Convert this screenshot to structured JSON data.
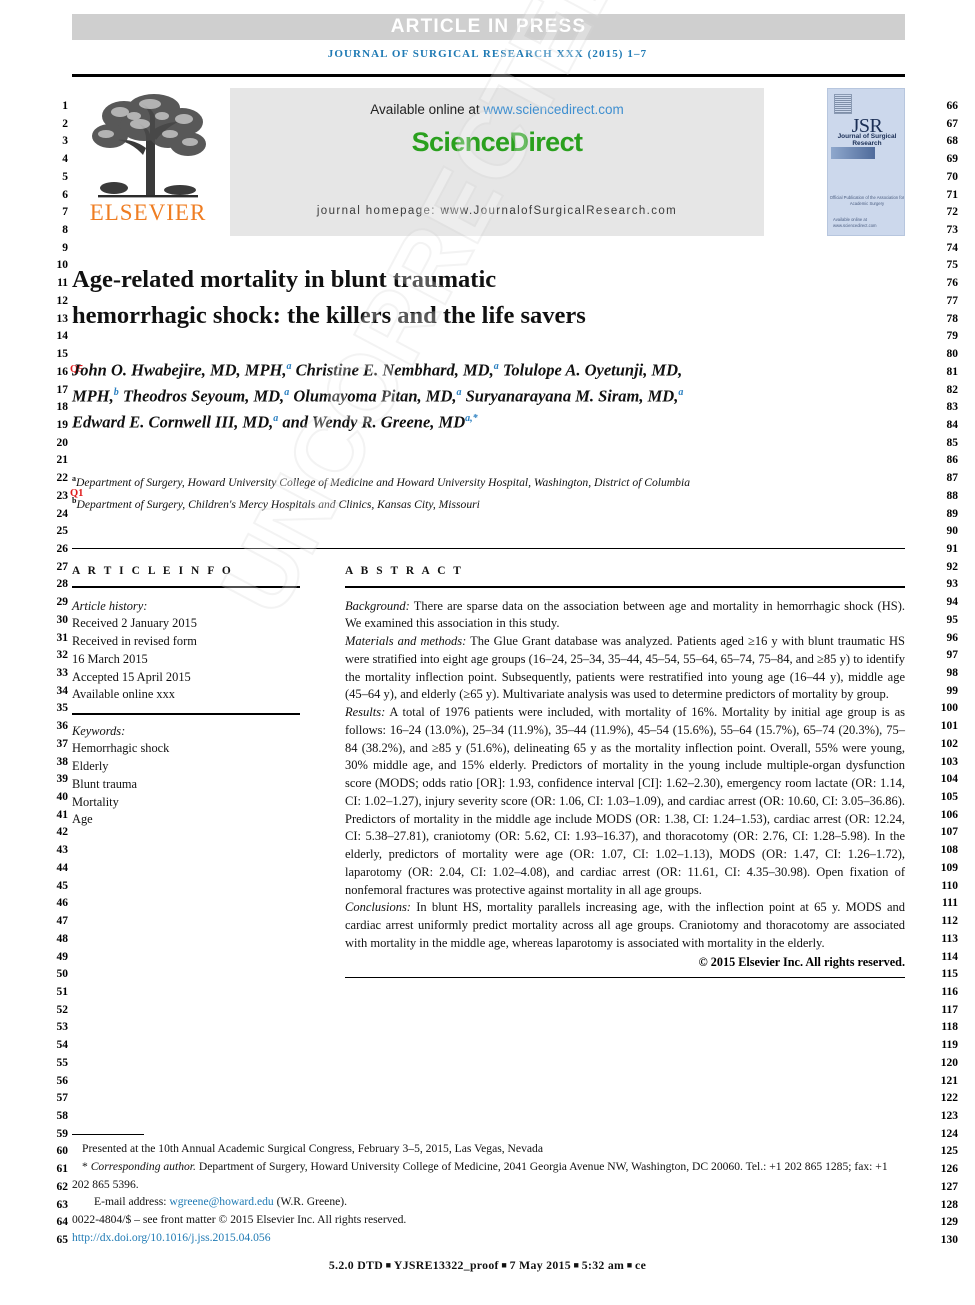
{
  "banner": {
    "article_in_press": "ARTICLE IN PRESS",
    "journal_citation": "JOURNAL OF SURGICAL RESEARCH XXX (2015) 1–7"
  },
  "masthead": {
    "publisher_logo_text": "ELSEVIER",
    "available_online_prefix": "Available online at",
    "sciencedirect_url": "www.sciencedirect.com",
    "sciencedirect_logo": "ScienceDirect",
    "journal_homepage": "journal homepage: www.JournalofSurgicalResearch.com",
    "cover": {
      "title": "JSR",
      "subtitle": "Journal of Surgical Research",
      "footnote": "Official Publication of the Association for Academic Surgery",
      "url_note": "Available online at www.sciencedirect.com"
    }
  },
  "article": {
    "title_line1": "Age-related mortality in blunt traumatic",
    "title_line2": "hemorrhagic shock: the killers and the life savers",
    "authors_html": "John O. Hwabejire, MD, MPH,<sup>a</sup> Christine E. Nembhard, MD,<sup>a</sup> Tolulope A. Oyetunji, MD, MPH,<sup>b</sup> Theodros Seyoum, MD,<sup>a</sup> Olumayoma Pitan, MD,<sup>a</sup> Suryanarayana M. Siram, MD,<sup>a</sup> Edward E. Cornwell III, MD,<sup>a</sup> and Wendy R. Greene, MD<sup>a,*</sup>",
    "affiliation_a": "Department of Surgery, Howard University College of Medicine and Howard University Hospital, Washington, District of Columbia",
    "affiliation_b": "Department of Surgery, Children's Mercy Hospitals and Clinics, Kansas City, Missouri",
    "affiliation_a_marker": "a",
    "affiliation_b_marker": "b"
  },
  "article_info": {
    "heading": "A R T I C L E   I N F O",
    "history_label": "Article history:",
    "history": [
      "Received 2 January 2015",
      "Received in revised form",
      "16 March 2015",
      "Accepted 15 April 2015",
      "Available online xxx"
    ],
    "keywords_label": "Keywords:",
    "keywords": [
      "Hemorrhagic shock",
      "Elderly",
      "Blunt trauma",
      "Mortality",
      "Age"
    ]
  },
  "abstract": {
    "heading": "A B S T R A C T",
    "sections": [
      {
        "label": "Background:",
        "text": " There are sparse data on the association between age and mortality in hemorrhagic shock (HS). We examined this association in this study."
      },
      {
        "label": "Materials and methods:",
        "text": " The Glue Grant database was analyzed. Patients aged ≥16 y with blunt traumatic HS were stratified into eight age groups (16–24, 25–34, 35–44, 45–54, 55–64, 65–74, 75–84, and ≥85 y) to identify the mortality inflection point. Subsequently, patients were restratified into young age (16–44 y), middle age (45–64 y), and elderly (≥65 y). Multivariate analysis was used to determine predictors of mortality by group."
      },
      {
        "label": "Results:",
        "text": " A total of 1976 patients were included, with mortality of 16%. Mortality by initial age group is as follows: 16–24 (13.0%), 25–34 (11.9%), 35–44 (11.9%), 45–54 (15.6%), 55–64 (15.7%), 65–74 (20.3%), 75–84 (38.2%), and ≥85 y (51.6%), delineating 65 y as the mortality inflection point. Overall, 55% were young, 30% middle age, and 15% elderly. Predictors of mortality in the young include multiple-organ dysfunction score (MODS; odds ratio [OR]: 1.93, confidence interval [CI]: 1.62–2.30), emergency room lactate (OR: 1.14, CI: 1.02–1.27), injury severity score (OR: 1.06, CI: 1.03–1.09), and cardiac arrest (OR: 10.60, CI: 3.05–36.86). Predictors of mortality in the middle age include MODS (OR: 1.38, CI: 1.24–1.53), cardiac arrest (OR: 12.24, CI: 5.38–27.81), craniotomy (OR: 5.62, CI: 1.93–16.37), and thoracotomy (OR: 2.76, CI: 1.28–5.98). In the elderly, predictors of mortality were age (OR: 1.07, CI: 1.02–1.13), MODS (OR: 1.47, CI: 1.26–1.72), laparotomy (OR: 2.04, CI: 1.02–4.08), and cardiac arrest (OR: 11.61, CI: 4.35–30.98). Open fixation of nonfemoral fractures was protective against mortality in all age groups."
      },
      {
        "label": "Conclusions:",
        "text": " In blunt HS, mortality parallels increasing age, with the inflection point at 65 y. MODS and cardiac arrest uniformly predict mortality across all age groups. Craniotomy and thoracotomy are associated with mortality in the middle age, whereas laparotomy is associated with mortality in the elderly."
      }
    ],
    "copyright": "© 2015 Elsevier Inc. All rights reserved."
  },
  "footnotes": {
    "presented": "Presented at the 10th Annual Academic Surgical Congress, February 3–5, 2015, Las Vegas, Nevada",
    "corresponding_marker": "*",
    "corresponding_label": "Corresponding author.",
    "corresponding_text": " Department of Surgery, Howard University College of Medicine, 2041 Georgia Avenue NW, Washington, DC 20060. Tel.: +1 202 865 1285; fax: +1 202 865 5396.",
    "email_label": "E-mail address:",
    "email": "wgreene@howard.edu",
    "email_suffix": "(W.R. Greene).",
    "frontmatter": "0022-4804/$ – see front matter © 2015 Elsevier Inc. All rights reserved.",
    "doi": "http://dx.doi.org/10.1016/j.jss.2015.04.056"
  },
  "proof_footer": {
    "dtd": "5.2.0 DTD",
    "proof_id": "YJSRE13322_proof",
    "date": "7 May 2015",
    "time": "5:32 am",
    "code": "ce",
    "separator": "■"
  },
  "query_markers": [
    {
      "id": "Q5",
      "line": 16
    },
    {
      "id": "Q1",
      "line": 23
    }
  ],
  "line_numbers": {
    "left_start": 1,
    "left_end": 65,
    "right_start": 66,
    "right_end": 130
  },
  "watermark": "UNCORRECTED PROOF",
  "colors": {
    "journal_blue": "#1f7ab4",
    "sciencedirect_green": "#2aa01e",
    "elsevier_orange": "#ef7d22",
    "link_blue": "#3f8fd0",
    "query_red": "#e01b1b",
    "banner_gray": "#cfcfcf",
    "panel_gray": "#e6e6e6"
  }
}
